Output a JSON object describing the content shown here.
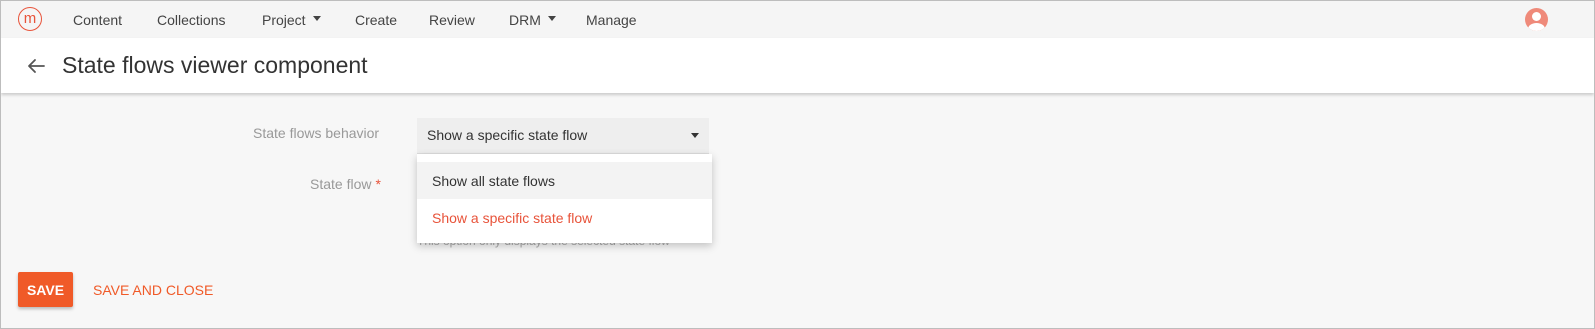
{
  "nav": {
    "logo_letter": "m",
    "items": [
      {
        "label": "Content",
        "dropdown": false
      },
      {
        "label": "Collections",
        "dropdown": false
      },
      {
        "label": "Project",
        "dropdown": true
      },
      {
        "label": "Create",
        "dropdown": false
      },
      {
        "label": "Review",
        "dropdown": false
      },
      {
        "label": "DRM",
        "dropdown": true
      },
      {
        "label": "Manage",
        "dropdown": false
      }
    ],
    "avatar_icon": "user-avatar-icon"
  },
  "header": {
    "back_icon": "arrow-left-icon",
    "title": "State flows viewer component"
  },
  "form": {
    "behavior_label": "State flows behavior",
    "behavior_value": "Show a specific state flow",
    "state_flow_label": "State flow",
    "required_mark": "*",
    "hint": "This option only displays the selected state flow",
    "dropdown_options": [
      {
        "label": "Show all state flows",
        "selected": false
      },
      {
        "label": "Show a specific state flow",
        "selected": true
      }
    ]
  },
  "actions": {
    "save_label": "SAVE",
    "save_close_label": "SAVE AND CLOSE"
  },
  "colors": {
    "accent": "#f05a28",
    "logo": "#e8533a",
    "avatar": "#ef8a7a"
  }
}
